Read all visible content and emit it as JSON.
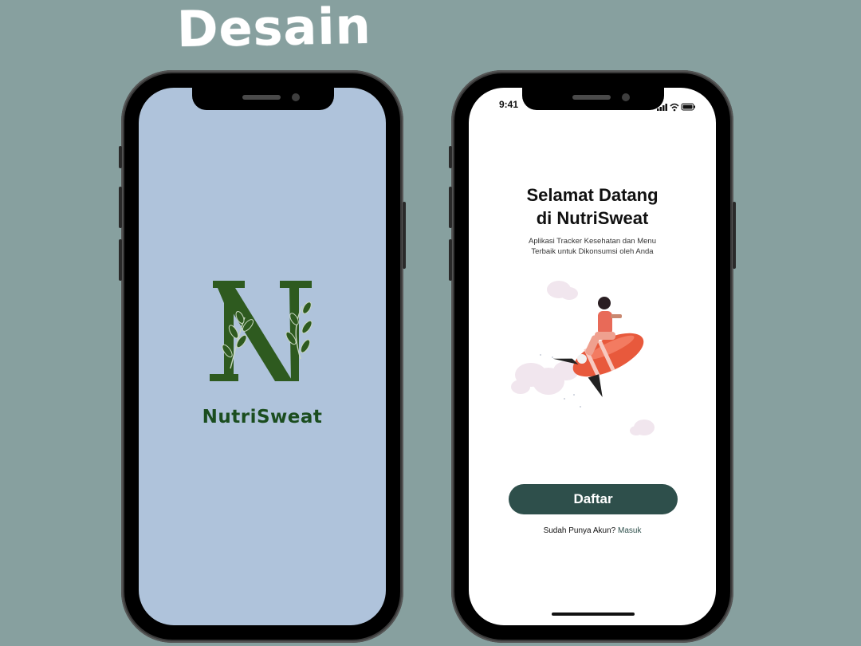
{
  "page": {
    "title": "Desain",
    "background": "#87A09F"
  },
  "splash_screen": {
    "background": "#AFC3DB",
    "logo_icon": "leaf-letter-n-logo",
    "app_name": "NutriSweat",
    "brand_color": "#1B4D1F"
  },
  "welcome_screen": {
    "status_bar": {
      "time": "9:41",
      "icons": [
        "signal-icon",
        "wifi-icon",
        "battery-icon"
      ]
    },
    "title_line1": "Selamat Datang",
    "title_line2": "di NutriSweat",
    "subtitle_line1": "Aplikasi Tracker Kesehatan dan Menu",
    "subtitle_line2": "Terbaik untuk Dikonsumsi oleh Anda",
    "illustration": "rocket-rider-illustration",
    "register_button": "Daftar",
    "login_prompt": "Sudah Punya Akun?",
    "login_link": "Masuk",
    "accent": "#2E4F4B"
  }
}
